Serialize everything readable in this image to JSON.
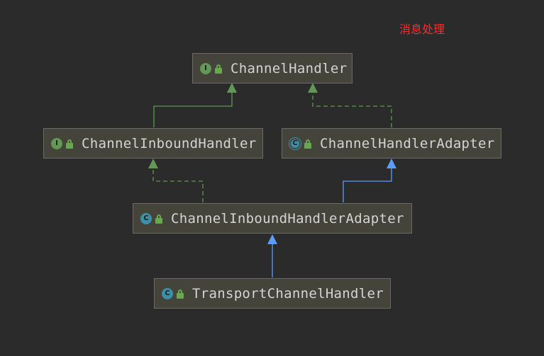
{
  "note": "消息处理",
  "colors": {
    "interface_edge": "#629755",
    "class_edge": "#5c9dff"
  },
  "nodes": [
    {
      "id": "channel-handler",
      "label": "ChannelHandler",
      "kind": "interface",
      "badge": "I",
      "badge_icon": "interface-icon"
    },
    {
      "id": "channel-inbound-handler",
      "label": "ChannelInboundHandler",
      "kind": "interface",
      "badge": "I",
      "badge_icon": "interface-icon"
    },
    {
      "id": "channel-handler-adapter",
      "label": "ChannelHandlerAdapter",
      "kind": "abstract",
      "badge": "C",
      "badge_icon": "abstract-class-icon"
    },
    {
      "id": "channel-inbound-handler-adapter",
      "label": "ChannelInboundHandlerAdapter",
      "kind": "class",
      "badge": "C",
      "badge_icon": "class-icon"
    },
    {
      "id": "transport-channel-handler",
      "label": "TransportChannelHandler",
      "kind": "class",
      "badge": "C",
      "badge_icon": "class-icon"
    }
  ],
  "edges": [
    {
      "from": "channel-inbound-handler",
      "to": "channel-handler",
      "relation": "extends",
      "style": "solid-green"
    },
    {
      "from": "channel-handler-adapter",
      "to": "channel-handler",
      "relation": "implements",
      "style": "dashed-green"
    },
    {
      "from": "channel-inbound-handler-adapter",
      "to": "channel-inbound-handler",
      "relation": "implements",
      "style": "dashed-green"
    },
    {
      "from": "channel-inbound-handler-adapter",
      "to": "channel-handler-adapter",
      "relation": "extends",
      "style": "solid-blue"
    },
    {
      "from": "transport-channel-handler",
      "to": "channel-inbound-handler-adapter",
      "relation": "extends",
      "style": "solid-blue"
    }
  ]
}
